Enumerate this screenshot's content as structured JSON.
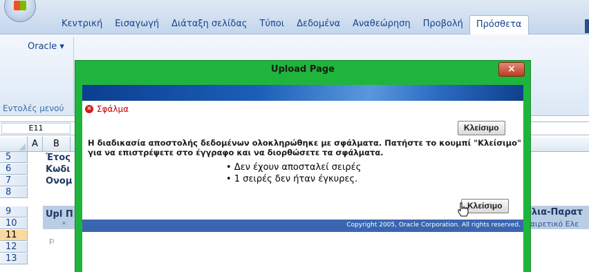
{
  "ribbon": {
    "tabs": [
      "Κεντρική",
      "Εισαγωγή",
      "Διάταξη σελίδας",
      "Τύποι",
      "Δεδομένα",
      "Αναθεώρηση",
      "Προβολή",
      "Πρόσθετα"
    ],
    "active_tab": "Πρόσθετα",
    "oracle_menu": "Oracle ▾",
    "group_label": "Εντολές μενού"
  },
  "formula_bar": {
    "namebox": "E11"
  },
  "grid": {
    "columns": [
      "A",
      "B"
    ],
    "rows": [
      "5",
      "6",
      "7",
      "8",
      "9",
      "10",
      "11",
      "12",
      "13"
    ],
    "active_row": "11",
    "cells": [
      "Έτος",
      "Κωδι",
      "Ονομ",
      "Upl Π"
    ],
    "asterisk": "*",
    "right_title": "όλια-Παρατ",
    "right_sub": "οαιρετικό Ελε"
  },
  "dialog": {
    "title": "Upload Page",
    "close_symbol": "×",
    "error_label": "Σφάλμα",
    "close_button": "Κλείσιμο",
    "message_line1": "Η διαδικασία αποστολής δεδομένων ολοκληρώθηκε με σφάλματα. Πατήστε το κουμπί \"Κλείσιμο\"",
    "message_line2": "για να επιστρέψετε στο έγγραφο και να διορθώσετε τα σφάλματα.",
    "bullets": [
      "Δεν έχουν αποσταλεί σειρές",
      "1 σειρές δεν ήταν έγκυρες."
    ],
    "copyright": "Copyright 2005, Oracle Corporation. All rights reserved."
  }
}
